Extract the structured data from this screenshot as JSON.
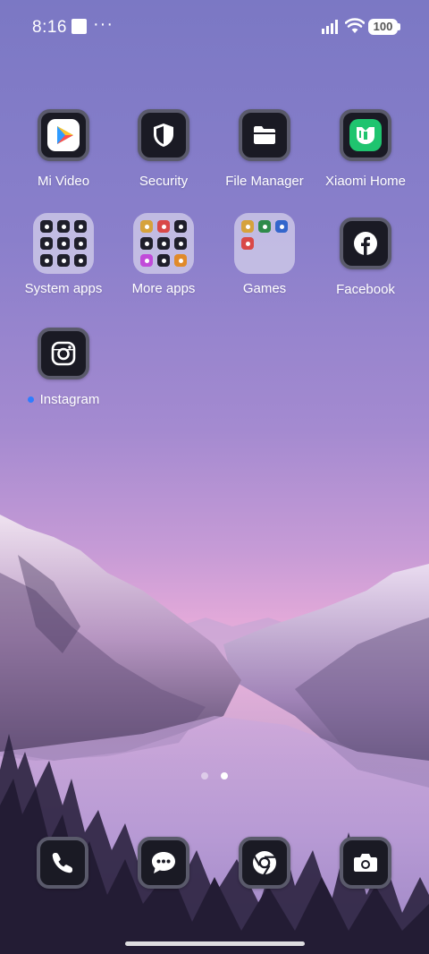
{
  "status_bar": {
    "time": "8:16",
    "more": "···",
    "battery": "100"
  },
  "apps": [
    {
      "name": "mi-video",
      "label": "Mi Video",
      "icon": "mi-video-icon"
    },
    {
      "name": "security",
      "label": "Security",
      "icon": "shield-icon"
    },
    {
      "name": "file-manager",
      "label": "File Manager",
      "icon": "folder-icon"
    },
    {
      "name": "xiaomi-home",
      "label": "Xiaomi Home",
      "icon": "xiaomi-home-icon"
    },
    {
      "name": "system-apps",
      "label": "System apps",
      "icon": "folder"
    },
    {
      "name": "more-apps",
      "label": "More apps",
      "icon": "folder"
    },
    {
      "name": "games",
      "label": "Games",
      "icon": "folder"
    },
    {
      "name": "facebook",
      "label": "Facebook",
      "icon": "facebook-icon"
    },
    {
      "name": "instagram",
      "label": "Instagram",
      "icon": "instagram-icon",
      "new_badge": true
    }
  ],
  "dock": [
    {
      "name": "phone",
      "icon": "phone-icon"
    },
    {
      "name": "messages",
      "icon": "message-icon"
    },
    {
      "name": "chrome",
      "icon": "chrome-icon"
    },
    {
      "name": "camera",
      "icon": "camera-icon"
    }
  ],
  "pages": {
    "count": 2,
    "active": 2
  },
  "colors": {
    "icon_bg": "#1a1a24",
    "icon_border": "#5a5a6b",
    "new_badge": "#2f7dff",
    "xiaomi_home_green": "#1fc46f"
  }
}
